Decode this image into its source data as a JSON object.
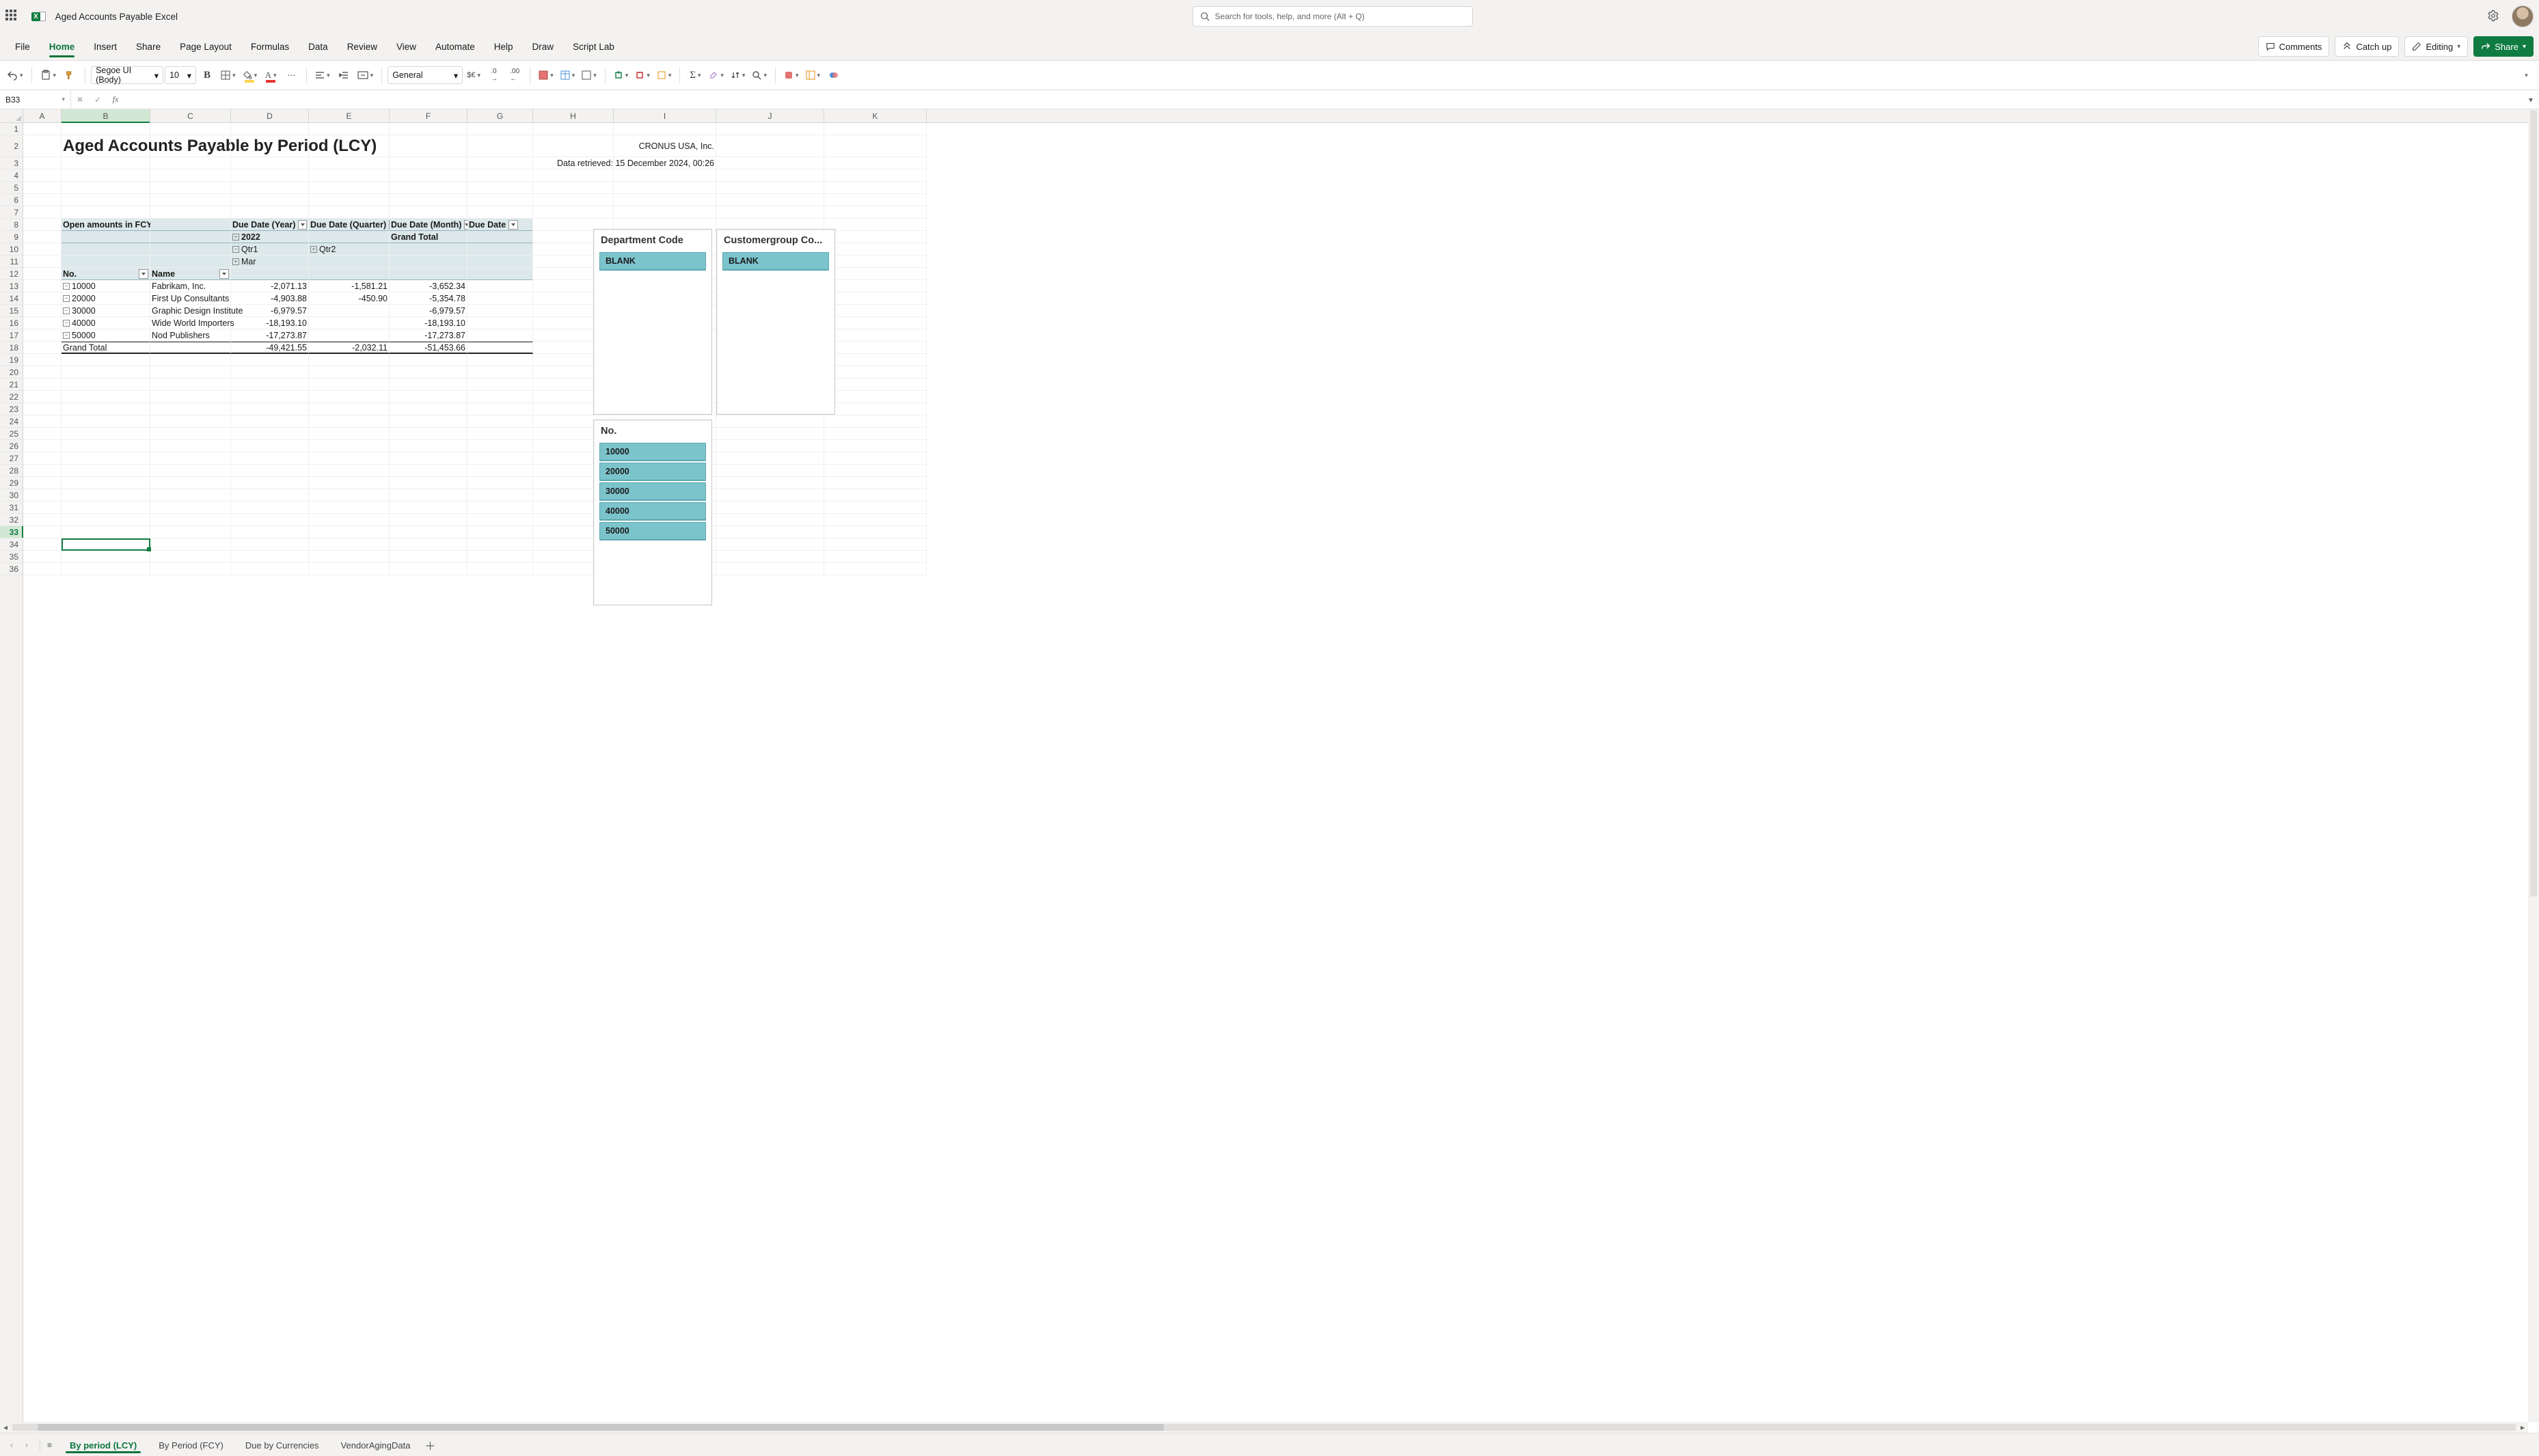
{
  "app": {
    "doc_title": "Aged Accounts Payable Excel",
    "search_placeholder": "Search for tools, help, and more (Alt + Q)"
  },
  "ribbon": {
    "tabs": [
      "File",
      "Home",
      "Insert",
      "Share",
      "Page Layout",
      "Formulas",
      "Data",
      "Review",
      "View",
      "Automate",
      "Help",
      "Draw",
      "Script Lab"
    ],
    "active": "Home",
    "comments": "Comments",
    "catchup": "Catch up",
    "editing": "Editing",
    "share": "Share"
  },
  "toolbar": {
    "font_name": "Segoe UI (Body)",
    "font_size": "10",
    "number_format": "General"
  },
  "formula_bar": {
    "name_box": "B33",
    "formula": ""
  },
  "columns": [
    "A",
    "B",
    "C",
    "D",
    "E",
    "F",
    "G",
    "H",
    "I",
    "J",
    "K"
  ],
  "rows_visible": 36,
  "report": {
    "title": "Aged Accounts Payable by Period (LCY)",
    "company": "CRONUS USA, Inc.",
    "retrieved": "Data retrieved: 15 December 2024, 00:26"
  },
  "pivot": {
    "open_amounts_label": "Open amounts in FCY",
    "headers": {
      "year": "Due Date (Year)",
      "quarter": "Due Date (Quarter)",
      "month": "Due Date (Month)",
      "due_date": "Due Date"
    },
    "year_value": "2022",
    "q1": "Qtr1",
    "q2": "Qtr2",
    "month_value": "Mar",
    "grand_total_col_label": "Grand Total",
    "no_label": "No.",
    "name_label": "Name",
    "rows": [
      {
        "no": "10000",
        "name": "Fabrikam, Inc.",
        "qtr1": "-2,071.13",
        "qtr2": "-1,581.21",
        "gt": "-3,652.34"
      },
      {
        "no": "20000",
        "name": "First Up Consultants",
        "qtr1": "-4,903.88",
        "qtr2": "-450.90",
        "gt": "-5,354.78"
      },
      {
        "no": "30000",
        "name": "Graphic Design Institute",
        "qtr1": "-6,979.57",
        "qtr2": "",
        "gt": "-6,979.57"
      },
      {
        "no": "40000",
        "name": "Wide World Importers",
        "qtr1": "-18,193.10",
        "qtr2": "",
        "gt": "-18,193.10"
      },
      {
        "no": "50000",
        "name": "Nod Publishers",
        "qtr1": "-17,273.87",
        "qtr2": "",
        "gt": "-17,273.87"
      }
    ],
    "grand_total_label": "Grand Total",
    "grand_total": {
      "qtr1": "-49,421.55",
      "qtr2": "-2,032.11",
      "gt": "-51,453.66"
    }
  },
  "slicers": {
    "dept": {
      "title": "Department Code",
      "items": [
        "BLANK"
      ]
    },
    "custgrp": {
      "title": "Customergroup Co...",
      "items": [
        "BLANK"
      ]
    },
    "no": {
      "title": "No.",
      "items": [
        "10000",
        "20000",
        "30000",
        "40000",
        "50000"
      ]
    }
  },
  "sheets": {
    "tabs": [
      "By period (LCY)",
      "By Period (FCY)",
      "Due by Currencies",
      "VendorAgingData"
    ],
    "active": "By period (LCY)"
  }
}
